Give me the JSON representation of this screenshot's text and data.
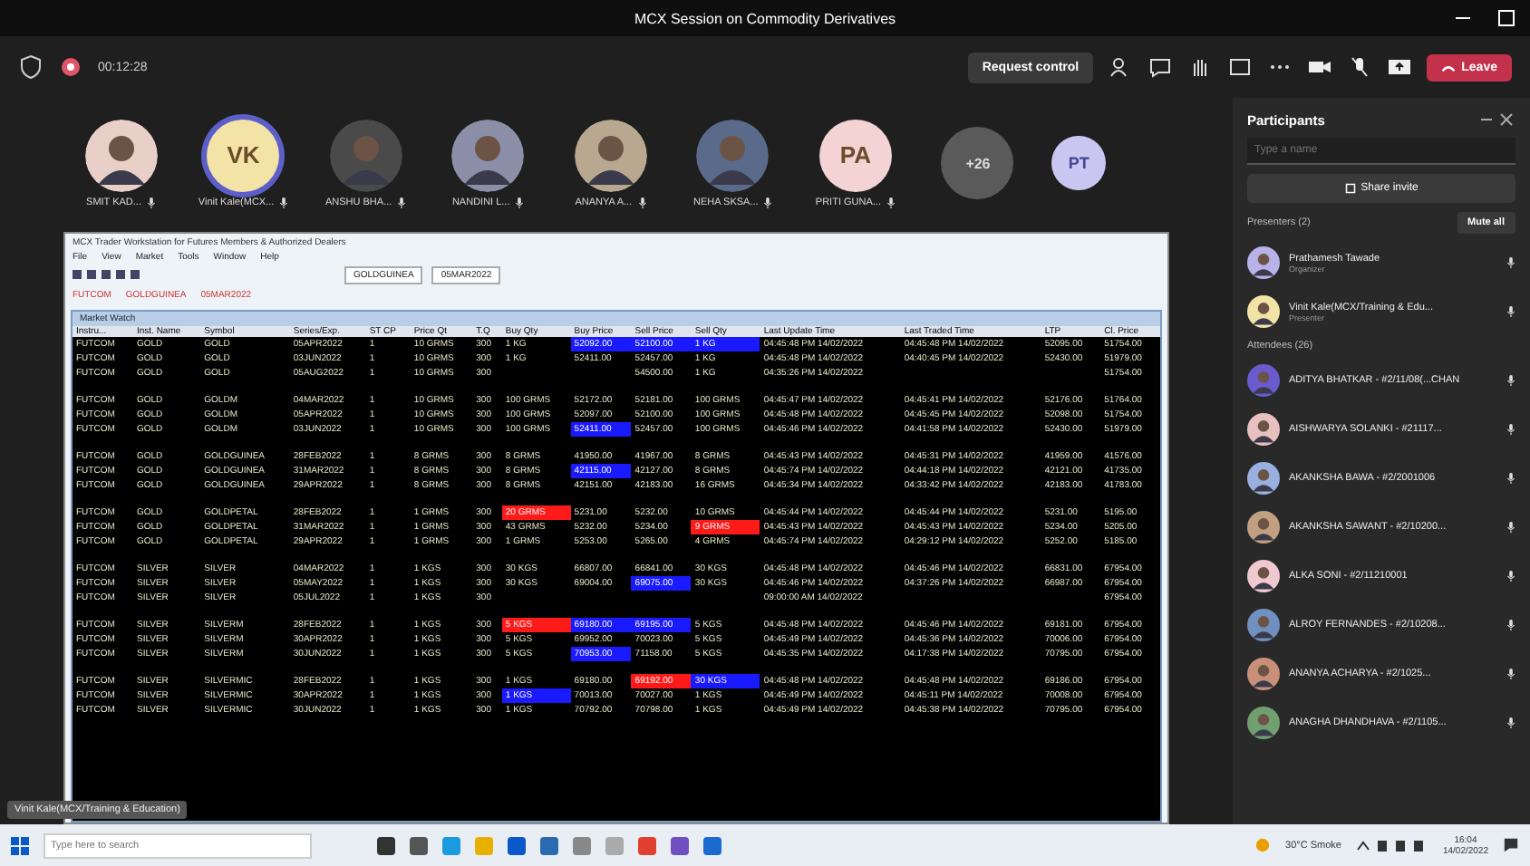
{
  "window": {
    "title": "MCX Session on Commodity Derivatives"
  },
  "meeting_bar": {
    "timer": "00:12:28",
    "request_control": "Request control",
    "leave": "Leave"
  },
  "gallery": [
    {
      "kind": "photo",
      "name": "SMIT KAD...",
      "color": "#e8d0c8"
    },
    {
      "kind": "initials",
      "initials": "VK",
      "name": "Vinit Kale(MCX...",
      "color": "#f3e3a6",
      "selected": true
    },
    {
      "kind": "photo",
      "name": "ANSHU BHA...",
      "color": "#4a4a4a",
      "selected": false
    },
    {
      "kind": "photo",
      "name": "NANDINI L...",
      "color": "#8c8fa8",
      "selected": false
    },
    {
      "kind": "photo",
      "name": "ANANYA A...",
      "color": "#b8a890",
      "selected": false
    },
    {
      "kind": "photo",
      "name": "NEHA SKSA...",
      "color": "#5a6a8a",
      "selected": false
    },
    {
      "kind": "initials",
      "initials": "PA",
      "name": "PRITI GUNA...",
      "color": "#f3d3d3",
      "selected": false
    },
    {
      "kind": "more",
      "initials": "+26",
      "color": "#5a5a5a",
      "selected": false
    }
  ],
  "stage_avatar": {
    "initials": "PT"
  },
  "shared_screen": {
    "title": "MCX Trader Workstation for Futures Members & Authorized Dealers",
    "menu": [
      "File",
      "View",
      "Market",
      "Tools",
      "Window",
      "Help"
    ],
    "selectors": [
      "GOLDGUINEA",
      "05MAR2022"
    ],
    "filters": [
      "FUTCOM",
      "GOLDGUINEA",
      "05MAR2022"
    ],
    "watch_title": "Market Watch",
    "columns": [
      "Instru...",
      "Inst. Name",
      "Symbol",
      "Series/Exp.",
      "ST CP",
      "Price Qt",
      "T.Q",
      "Buy Qty",
      "Buy Price",
      "Sell Price",
      "Sell Qty",
      "Last Update Time",
      "Last Traded Time",
      "LTP",
      "Cl. Price"
    ],
    "groups": [
      {
        "rows": [
          [
            "FUTCOM",
            "GOLD",
            "GOLD",
            "05APR2022",
            "1",
            "10 GRMS",
            "300",
            "1 KG",
            {
              "text": "52092.00",
              "color": "#1a1aff"
            },
            {
              "text": "52100.00",
              "color": "#1a1aff"
            },
            {
              "text": "1 KG",
              "color": "#1a1aff"
            },
            "04:45:48 PM 14/02/2022",
            "04:45:48 PM 14/02/2022",
            "52095.00",
            "51754.00"
          ],
          [
            "FUTCOM",
            "GOLD",
            "GOLD",
            "03JUN2022",
            "1",
            "10 GRMS",
            "300",
            "1 KG",
            "52411.00",
            "52457.00",
            "1 KG",
            "04:45:48 PM 14/02/2022",
            "04:40:45 PM 14/02/2022",
            "52430.00",
            "51979.00"
          ],
          [
            "FUTCOM",
            "GOLD",
            "GOLD",
            "05AUG2022",
            "1",
            "10 GRMS",
            "300",
            "",
            "",
            "54500.00",
            "1 KG",
            "04:35:26 PM 14/02/2022",
            "",
            "",
            "51754.00"
          ]
        ]
      },
      {
        "rows": [
          [
            "FUTCOM",
            "GOLD",
            "GOLDM",
            "04MAR2022",
            "1",
            "10 GRMS",
            "300",
            "100 GRMS",
            "52172.00",
            "52181.00",
            "100 GRMS",
            "04:45:47 PM 14/02/2022",
            "04:45:41 PM 14/02/2022",
            "52176.00",
            "51764.00"
          ],
          [
            "FUTCOM",
            "GOLD",
            "GOLDM",
            "05APR2022",
            "1",
            "10 GRMS",
            "300",
            "100 GRMS",
            "52097.00",
            "52100.00",
            "100 GRMS",
            "04:45:48 PM 14/02/2022",
            "04:45:45 PM 14/02/2022",
            "52098.00",
            "51754.00"
          ],
          [
            "FUTCOM",
            "GOLD",
            "GOLDM",
            "03JUN2022",
            "1",
            "10 GRMS",
            "300",
            "100 GRMS",
            {
              "text": "52411.00",
              "color": "#1a1aff"
            },
            "52457.00",
            "100 GRMS",
            "04:45:46 PM 14/02/2022",
            "04:41:58 PM 14/02/2022",
            "52430.00",
            "51979.00"
          ]
        ]
      },
      {
        "rows": [
          [
            "FUTCOM",
            "GOLD",
            "GOLDGUINEA",
            "28FEB2022",
            "1",
            "8 GRMS",
            "300",
            "8 GRMS",
            "41950.00",
            "41967.00",
            "8 GRMS",
            "04:45:43 PM 14/02/2022",
            "04:45:31 PM 14/02/2022",
            "41959.00",
            "41576.00"
          ],
          [
            "FUTCOM",
            "GOLD",
            "GOLDGUINEA",
            "31MAR2022",
            "1",
            "8 GRMS",
            "300",
            "8 GRMS",
            {
              "text": "42115.00",
              "color": "#1a1aff"
            },
            "42127.00",
            "8 GRMS",
            "04:45:74 PM 14/02/2022",
            "04:44:18 PM 14/02/2022",
            "42121.00",
            "41735.00"
          ],
          [
            "FUTCOM",
            "GOLD",
            "GOLDGUINEA",
            "29APR2022",
            "1",
            "8 GRMS",
            "300",
            "8 GRMS",
            "42151.00",
            "42183.00",
            "16 GRMS",
            "04:45:34 PM 14/02/2022",
            "04:33:42 PM 14/02/2022",
            "42183.00",
            "41783.00"
          ]
        ]
      },
      {
        "rows": [
          [
            "FUTCOM",
            "GOLD",
            "GOLDPETAL",
            "28FEB2022",
            "1",
            "1 GRMS",
            "300",
            {
              "text": "20 GRMS",
              "color": "#ff1a1a"
            },
            "5231.00",
            "5232.00",
            "10 GRMS",
            "04:45:44 PM 14/02/2022",
            "04:45:44 PM 14/02/2022",
            "5231.00",
            "5195.00"
          ],
          [
            "FUTCOM",
            "GOLD",
            "GOLDPETAL",
            "31MAR2022",
            "1",
            "1 GRMS",
            "300",
            "43 GRMS",
            "5232.00",
            "5234.00",
            {
              "text": "9 GRMS",
              "color": "#ff1a1a"
            },
            "04:45:43 PM 14/02/2022",
            "04:45:43 PM 14/02/2022",
            "5234.00",
            "5205.00"
          ],
          [
            "FUTCOM",
            "GOLD",
            "GOLDPETAL",
            "29APR2022",
            "1",
            "1 GRMS",
            "300",
            "1 GRMS",
            "5253.00",
            "5265.00",
            "4 GRMS",
            "04:45:74 PM 14/02/2022",
            "04:29:12 PM 14/02/2022",
            "5252.00",
            "5185.00"
          ]
        ]
      },
      {
        "rows": [
          [
            "FUTCOM",
            "SILVER",
            "SILVER",
            "04MAR2022",
            "1",
            "1 KGS",
            "300",
            "30 KGS",
            "66807.00",
            "66841.00",
            "30 KGS",
            "04:45:48 PM 14/02/2022",
            "04:45:46 PM 14/02/2022",
            "66831.00",
            "67954.00"
          ],
          [
            "FUTCOM",
            "SILVER",
            "SILVER",
            "05MAY2022",
            "1",
            "1 KGS",
            "300",
            "30 KGS",
            "69004.00",
            {
              "text": "69075.00",
              "color": "#1a1aff"
            },
            "30 KGS",
            "04:45:46 PM 14/02/2022",
            "04:37:26 PM 14/02/2022",
            "66987.00",
            "67954.00"
          ],
          [
            "FUTCOM",
            "SILVER",
            "SILVER",
            "05JUL2022",
            "1",
            "1 KGS",
            "300",
            "",
            "",
            "",
            "",
            "09:00:00 AM 14/02/2022",
            "",
            "",
            "67954.00"
          ]
        ]
      },
      {
        "rows": [
          [
            "FUTCOM",
            "SILVER",
            "SILVERM",
            "28FEB2022",
            "1",
            "1 KGS",
            "300",
            {
              "text": "5 KGS",
              "color": "#ff1a1a"
            },
            {
              "text": "69180.00",
              "color": "#1a1aff"
            },
            {
              "text": "69195.00",
              "color": "#1a1aff"
            },
            "5 KGS",
            "04:45:48 PM 14/02/2022",
            "04:45:46 PM 14/02/2022",
            "69181.00",
            "67954.00"
          ],
          [
            "FUTCOM",
            "SILVER",
            "SILVERM",
            "30APR2022",
            "1",
            "1 KGS",
            "300",
            "5 KGS",
            "69952.00",
            "70023.00",
            "5 KGS",
            "04:45:49 PM 14/02/2022",
            "04:45:36 PM 14/02/2022",
            "70006.00",
            "67954.00"
          ],
          [
            "FUTCOM",
            "SILVER",
            "SILVERM",
            "30JUN2022",
            "1",
            "1 KGS",
            "300",
            "5 KGS",
            {
              "text": "70953.00",
              "color": "#1a1aff"
            },
            "71158.00",
            "5 KGS",
            "04:45:35 PM 14/02/2022",
            "04:17:38 PM 14/02/2022",
            "70795.00",
            "67954.00"
          ]
        ]
      },
      {
        "rows": [
          [
            "FUTCOM",
            "SILVER",
            "SILVERMIC",
            "28FEB2022",
            "1",
            "1 KGS",
            "300",
            "1 KGS",
            "69180.00",
            {
              "text": "69192.00",
              "color": "#ff1a1a"
            },
            {
              "text": "30 KGS",
              "color": "#1a1aff"
            },
            "04:45:48 PM 14/02/2022",
            "04:45:48 PM 14/02/2022",
            "69186.00",
            "67954.00"
          ],
          [
            "FUTCOM",
            "SILVER",
            "SILVERMIC",
            "30APR2022",
            "1",
            "1 KGS",
            "300",
            {
              "text": "1 KGS",
              "color": "#1a1aff"
            },
            "70013.00",
            "70027.00",
            "1 KGS",
            "04:45:49 PM 14/02/2022",
            "04:45:11 PM 14/02/2022",
            "70008.00",
            "67954.00"
          ],
          [
            "FUTCOM",
            "SILVER",
            "SILVERMIC",
            "30JUN2022",
            "1",
            "1 KGS",
            "300",
            "1 KGS",
            "70792.00",
            "70798.00",
            "1 KGS",
            "04:45:49 PM 14/02/2022",
            "04:45:38 PM 14/02/2022",
            "70795.00",
            "67954.00"
          ]
        ]
      }
    ]
  },
  "presenter_label": "Vinit Kale(MCX/Training & Education)",
  "participants": {
    "title": "Participants",
    "search": {
      "placeholder": "Type a name"
    },
    "share_invite": "Share invite",
    "presenters_header": "Presenters (2)",
    "mute_all": "Mute all",
    "presenters": [
      {
        "name": "Prathamesh Tawade",
        "role": "Organizer",
        "color": "#b9b2e8"
      },
      {
        "name": "Vinit Kale(MCX/Training & Edu...",
        "role": "Presenter",
        "color": "#f3e3a6"
      }
    ],
    "attendees_header": "Attendees (26)",
    "attendees": [
      {
        "name": "ADITYA BHATKAR - #2/11/08(...CHAN",
        "color": "#6a5acd"
      },
      {
        "name": "AISHWARYA SOLANKI - #21117...",
        "color": "#e8c0c0"
      },
      {
        "name": "AKANKSHA BAWA - #2/2001006",
        "color": "#9ab0e0"
      },
      {
        "name": "AKANKSHA SAWANT - #2/10200...",
        "color": "#c0a080"
      },
      {
        "name": "ALKA SONI - #2/11210001",
        "color": "#f0c8d0"
      },
      {
        "name": "ALROY FERNANDES - #2/10208...",
        "color": "#7090c0"
      },
      {
        "name": "ANANYA ACHARYA - #2/1025...",
        "color": "#c89078"
      },
      {
        "name": "ANAGHA DHANDHAVA - #2/1105...",
        "color": "#70a070"
      }
    ]
  },
  "taskbar": {
    "search": {
      "placeholder": "Type here to search"
    },
    "weather": "30°C Smoke",
    "time": "16:04",
    "date": "14/02/2022"
  }
}
